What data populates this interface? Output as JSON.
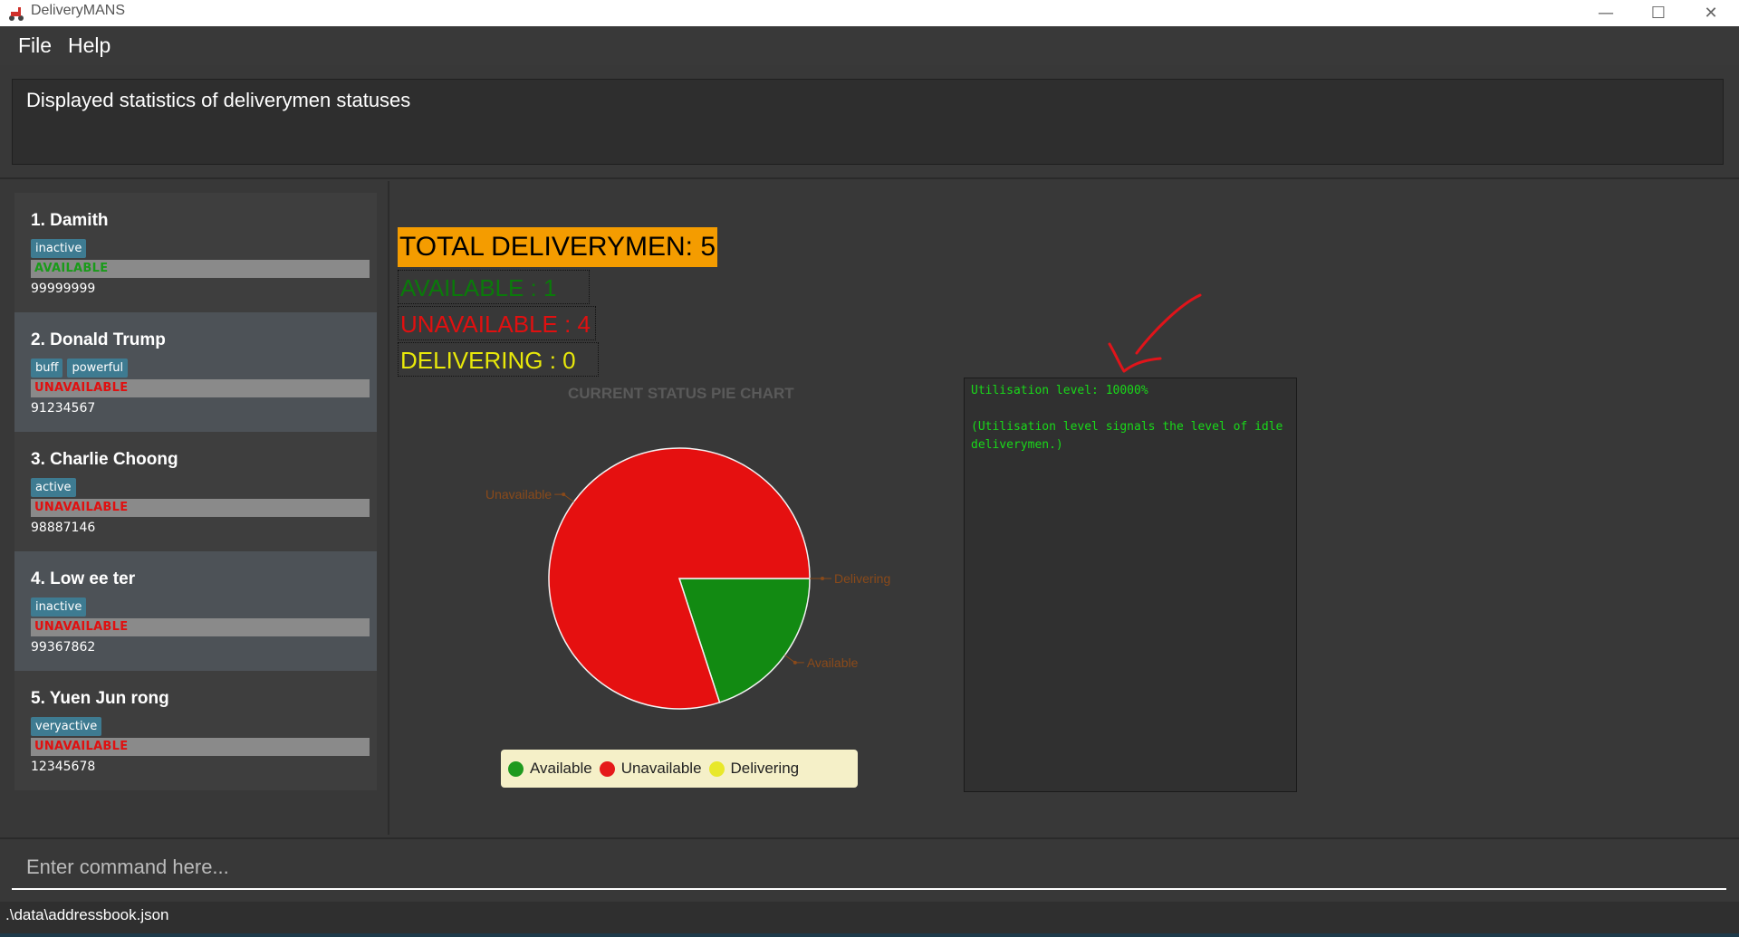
{
  "window": {
    "title": "DeliveryMANS",
    "minimize_glyph": "—",
    "maximize_glyph": "☐",
    "close_glyph": "✕",
    "icon": "scooter-icon"
  },
  "menu": {
    "file": "File",
    "help": "Help"
  },
  "result": {
    "text": "Displayed statistics of deliverymen statuses"
  },
  "deliverymen": [
    {
      "name": "1.  Damith",
      "tags": [
        "inactive"
      ],
      "status": "AVAILABLE",
      "status_color": "#1a9b1a",
      "phone": "99999999"
    },
    {
      "name": "2.  Donald Trump",
      "tags": [
        "buff",
        "powerful"
      ],
      "status": "UNAVAILABLE",
      "status_color": "#e01010",
      "phone": "91234567"
    },
    {
      "name": "3.  Charlie Choong",
      "tags": [
        "active"
      ],
      "status": "UNAVAILABLE",
      "status_color": "#e01010",
      "phone": "98887146"
    },
    {
      "name": "4.  Low ee ter",
      "tags": [
        "inactive"
      ],
      "status": "UNAVAILABLE",
      "status_color": "#e01010",
      "phone": "99367862"
    },
    {
      "name": "5.  Yuen Jun rong",
      "tags": [
        "veryactive"
      ],
      "status": "UNAVAILABLE",
      "status_color": "#e01010",
      "phone": "12345678"
    }
  ],
  "stats": {
    "total": "TOTAL DELIVERYMEN:  5",
    "available": "AVAILABLE      :  1",
    "unavailable": "UNAVAILABLE :  4",
    "delivering": "DELIVERING    :  0",
    "colors": {
      "total_bg": "#f49c00",
      "available": "#0a7a0a",
      "unavailable": "#e01010",
      "delivering": "#e8e80a"
    }
  },
  "chart_data": {
    "type": "pie",
    "title": "CURRENT STATUS PIE CHART",
    "slices": [
      {
        "label": "Available",
        "value": 1,
        "color": "#128a12"
      },
      {
        "label": "Unavailable",
        "value": 4,
        "color": "#e51010"
      },
      {
        "label": "Delivering",
        "value": 0,
        "color": "#e8e82a"
      }
    ],
    "legend": [
      "Available",
      "Unavailable",
      "Delivering"
    ],
    "legend_position": "bottom"
  },
  "utilisation": {
    "line1": "Utilisation level: 10000%",
    "line2": "(Utilisation level signals the level of idle deliverymen.)"
  },
  "command": {
    "placeholder": "Enter command here..."
  },
  "footer": {
    "path": ".\\data\\addressbook.json"
  }
}
